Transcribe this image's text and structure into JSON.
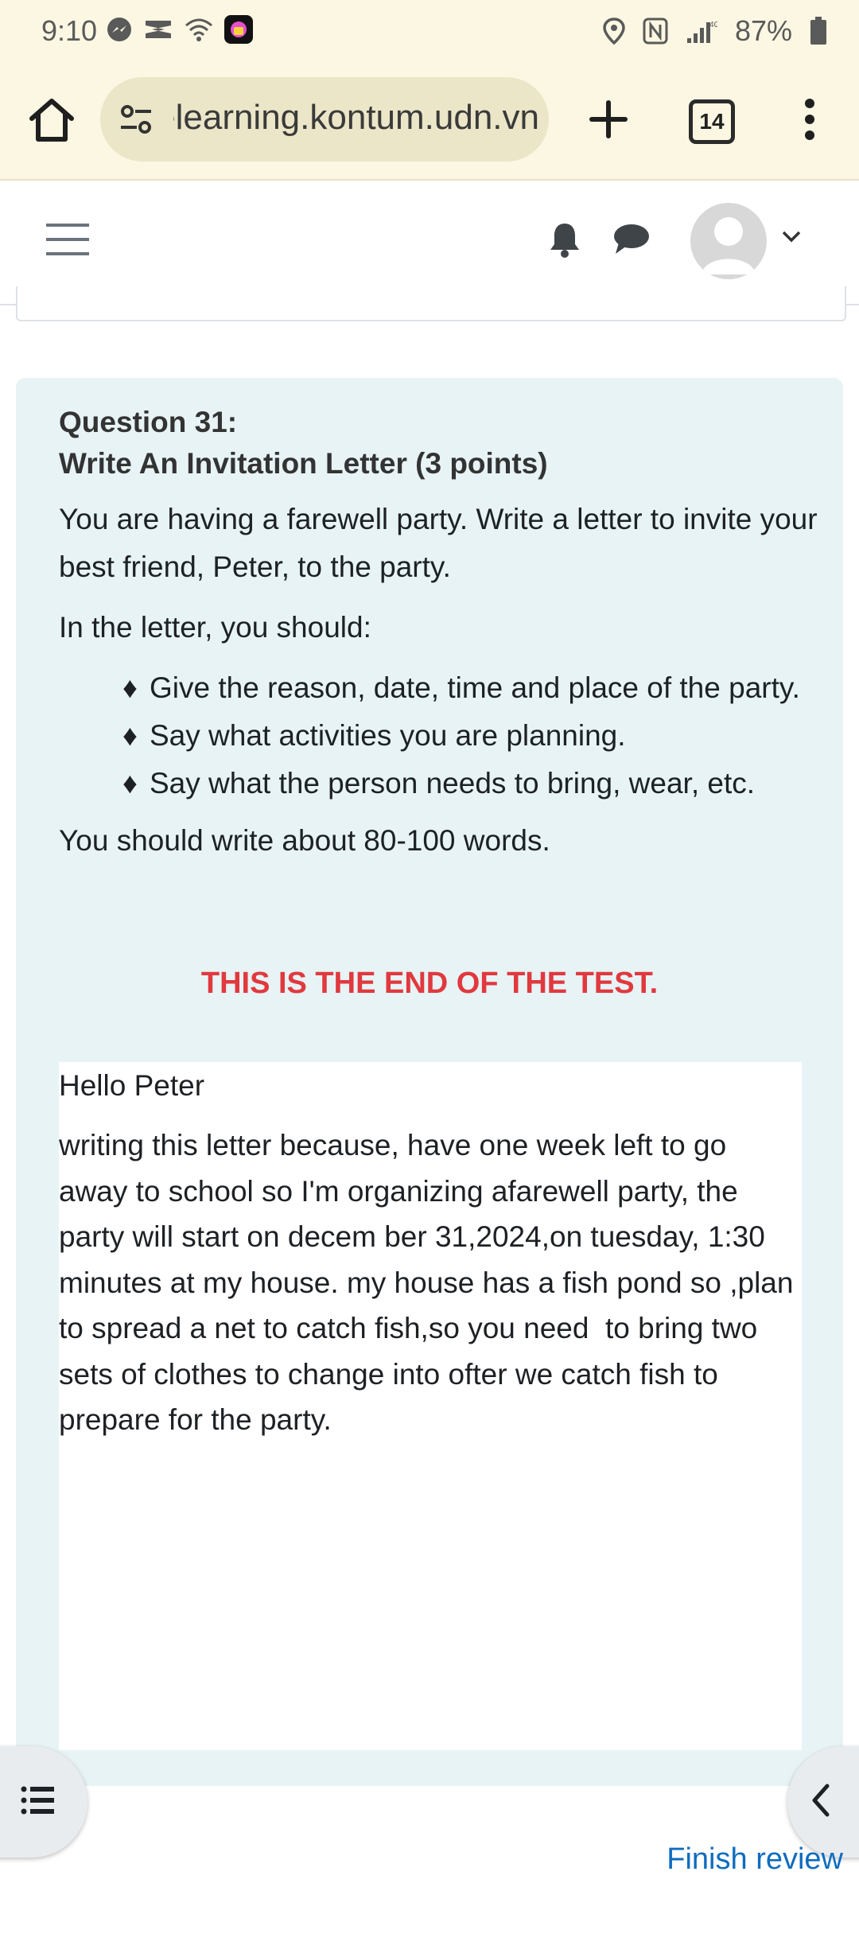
{
  "status_bar": {
    "time": "9:10",
    "battery": "87%",
    "network": "4G",
    "left_icons": [
      "messenger-icon",
      "capcut-icon",
      "wifi-icon",
      "app-icon"
    ],
    "right_icons": [
      "location-icon",
      "nfc-icon",
      "signal-icon",
      "battery-icon"
    ]
  },
  "browser": {
    "url": "elearning.kontum.udn.vn",
    "tab_count": "14"
  },
  "question": {
    "number": "Question 31:",
    "title": "Write An Invitation Letter (3 points)",
    "intro": "You are having a farewell party. Write a letter to invite your best friend, Peter, to the party.",
    "instruction": "In the letter, you should:",
    "bullet_symbol": "♦",
    "bullets": [
      "Give the reason, date, time and place of the party.",
      "Say what activities you are planning.",
      "Say what the person needs to bring, wear, etc."
    ],
    "word_count": "You should write about 80-100 words.",
    "end_note": "THIS IS THE END OF THE TEST."
  },
  "answer": {
    "greeting": "Hello Peter",
    "body": "writing this letter because, have one week left to go away to school so I'm organizing afarewell party, the party will start on decem ber 31,2024,on tuesday, 1:30 minutes at my house. my house has a fish pond so ,plan to spread a net to catch fish,so you need  to bring two sets of clothes to change into ofter we catch fish to prepare for the party."
  },
  "footer": {
    "finish_review": "Finish review"
  },
  "colors": {
    "chrome_bg": "#fbf7e2",
    "card_bg": "#e7f3f5",
    "end_note": "#e0393e",
    "link": "#0f6cbf"
  }
}
